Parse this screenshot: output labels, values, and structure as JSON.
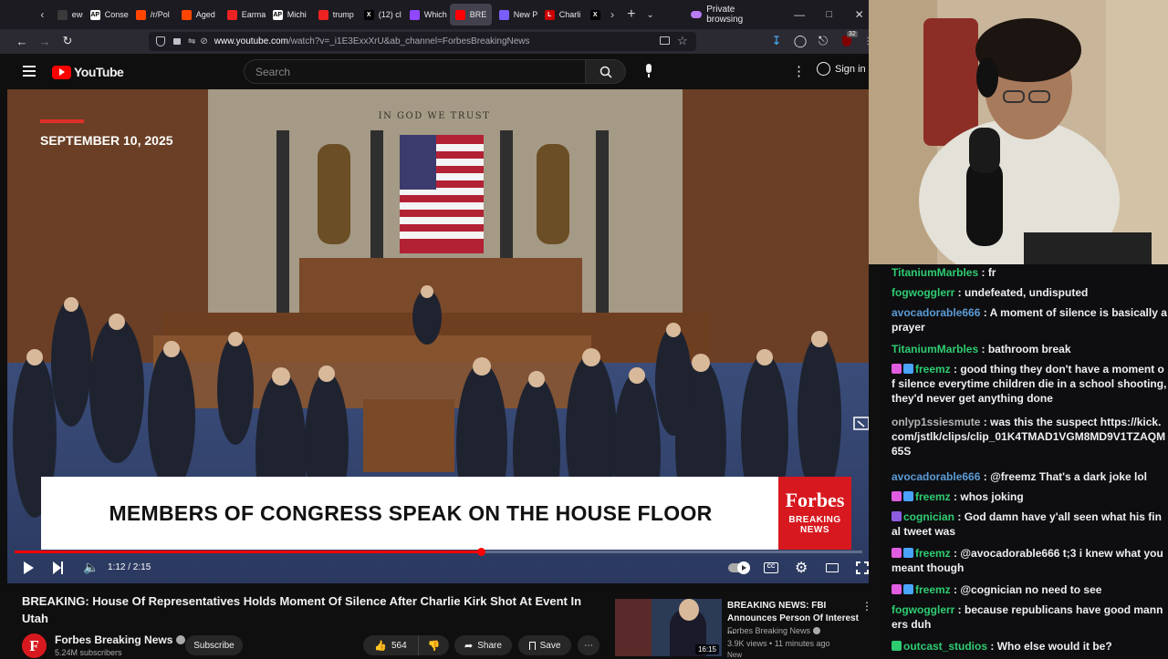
{
  "browser": {
    "tabs": [
      {
        "label": "ews",
        "favicon_color": "#3a3a3a",
        "glyph": ""
      },
      {
        "label": "Conse",
        "favicon_color": "#ffffff",
        "glyph": "AP"
      },
      {
        "label": "/r/Pol",
        "favicon_color": "#ff4500",
        "glyph": ""
      },
      {
        "label": "Aged",
        "favicon_color": "#ff4500",
        "glyph": ""
      },
      {
        "label": "Earma",
        "favicon_color": "#e22",
        "glyph": ""
      },
      {
        "label": "Michi",
        "favicon_color": "#ffffff",
        "glyph": "AP"
      },
      {
        "label": "trump",
        "favicon_color": "#e22",
        "glyph": ""
      },
      {
        "label": "(12) cl",
        "favicon_color": "#000000",
        "glyph": "X"
      },
      {
        "label": "Which",
        "favicon_color": "#9146ff",
        "glyph": ""
      },
      {
        "label": "BRE",
        "favicon_color": "#ff0000",
        "glyph": ""
      },
      {
        "label": "New P",
        "favicon_color": "#7a5cff",
        "glyph": ""
      },
      {
        "label": "Charli",
        "favicon_color": "#cc0000",
        "glyph": "L"
      },
      {
        "label": "",
        "favicon_color": "#000000",
        "glyph": "X"
      }
    ],
    "private_label": "Private browsing",
    "url_domain": "www.youtube.com",
    "url_path": "/watch?v=_i1E3ExxXrU&ab_channel=ForbesBreakingNews",
    "extension_badge": "32"
  },
  "youtube": {
    "logo_text": "YouTube",
    "search_placeholder": "Search",
    "sign_in_label": "Sign in"
  },
  "video": {
    "date_overlay": "SEPTEMBER 10, 2025",
    "engraving": "IN GOD WE TRUST",
    "lower_third": "MEMBERS OF CONGRESS SPEAK ON THE HOUSE FLOOR",
    "badge_brand": "Forbes",
    "badge_sub1": "BREAKING",
    "badge_sub2": "NEWS",
    "time_display": "1:12 / 2:15",
    "progress_fraction": 0.55
  },
  "meta": {
    "title": "BREAKING: House Of Representatives Holds Moment Of Silence After Charlie Kirk Shot At Event In Utah",
    "channel_name": "Forbes Breaking News",
    "subscribers": "5.24M subscribers",
    "subscribe_label": "Subscribe",
    "like_count": "564",
    "share_label": "Share",
    "save_label": "Save"
  },
  "recommended": {
    "title": "BREAKING NEWS: FBI Announces Person Of Interest ...",
    "channel": "Forbes Breaking News",
    "views": "3.9K views",
    "age": "11 minutes ago",
    "duration": "16:15",
    "extra": "New"
  },
  "chat": [
    {
      "user": "TitaniumMarbles",
      "color": "#2ecc71",
      "text": "fr",
      "badges": []
    },
    {
      "user": "fogwogglerr",
      "color": "#2ecc71",
      "text": "undefeated, undisputed",
      "badges": []
    },
    {
      "user": "avocadorable666",
      "color": "#5b9bd5",
      "text": "A moment of silence is basically a prayer",
      "badges": []
    },
    {
      "user": "TitaniumMarbles",
      "color": "#2ecc71",
      "text": "bathroom break",
      "badges": []
    },
    {
      "user": "freemz",
      "color": "#2ecc71",
      "text": "good thing they don't have a moment of silence everytime children die in a school shooting, they'd never get anything done",
      "badges": [
        "#e05ce0",
        "#4aa3ff"
      ]
    },
    {
      "user": "onlyp1ssiesmute",
      "color": "#b5b5b5",
      "text": "was this the suspect https://kick.com/jstlk/clips/clip_01K4TMAD1VGM8MD9V1TZAQM65S",
      "badges": []
    },
    {
      "user": "avocadorable666",
      "color": "#5b9bd5",
      "text": "@freemz That's a dark joke lol",
      "badges": []
    },
    {
      "user": "freemz",
      "color": "#2ecc71",
      "text": "whos joking",
      "badges": [
        "#e05ce0",
        "#4aa3ff"
      ]
    },
    {
      "user": "cognician",
      "color": "#2ecc71",
      "text": "God damn have y'all seen what his final tweet was",
      "badges": [
        "#8e5ce0"
      ]
    },
    {
      "user": "freemz",
      "color": "#2ecc71",
      "text": "@avocadorable666 t;3 i knew what you meant though",
      "badges": [
        "#e05ce0",
        "#4aa3ff"
      ]
    },
    {
      "user": "freemz",
      "color": "#2ecc71",
      "text": "@cognician no need to see",
      "badges": [
        "#e05ce0",
        "#4aa3ff"
      ]
    },
    {
      "user": "fogwogglerr",
      "color": "#2ecc71",
      "text": "because republicans have good manners duh",
      "badges": []
    },
    {
      "user": "outcast_studios",
      "color": "#2ecc71",
      "text": "Who else would it be?",
      "badges": [
        "#2ecc71"
      ]
    }
  ]
}
